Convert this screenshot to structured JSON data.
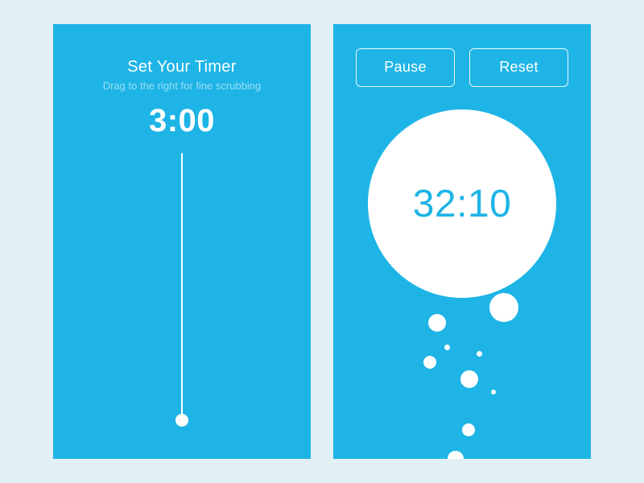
{
  "left": {
    "title": "Set Your Timer",
    "subtitle": "Drag to the right for fine scrubbing",
    "time": "3:00"
  },
  "right": {
    "pause": "Pause",
    "reset": "Reset",
    "time": "32:10"
  }
}
